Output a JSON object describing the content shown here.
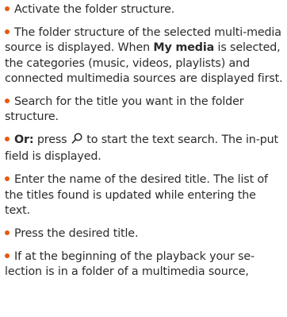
{
  "colors": {
    "bullet": "#e8590c",
    "text": "#2b2b2b"
  },
  "icons": {
    "search": "search-icon"
  },
  "instructions": [
    {
      "text": "Activate the folder structure."
    },
    {
      "text_before": "The folder structure of the selected multi-media source is displayed. When ",
      "bold": "My media",
      "text_after": " is selected, the categories (music, videos, playlists) and connected multimedia sources are displayed first."
    },
    {
      "text": "Search for the title you want in the folder structure."
    },
    {
      "bold": "Or:",
      "text_before": " press ",
      "text_after": " to start the text search. The in-put field is displayed."
    },
    {
      "text": "Enter the name of the desired title. The list of the titles found is updated while entering the text."
    },
    {
      "text": "Press the desired title."
    },
    {
      "text": "If at the beginning of the playback your se-lection is in a folder of a multimedia source,"
    }
  ]
}
